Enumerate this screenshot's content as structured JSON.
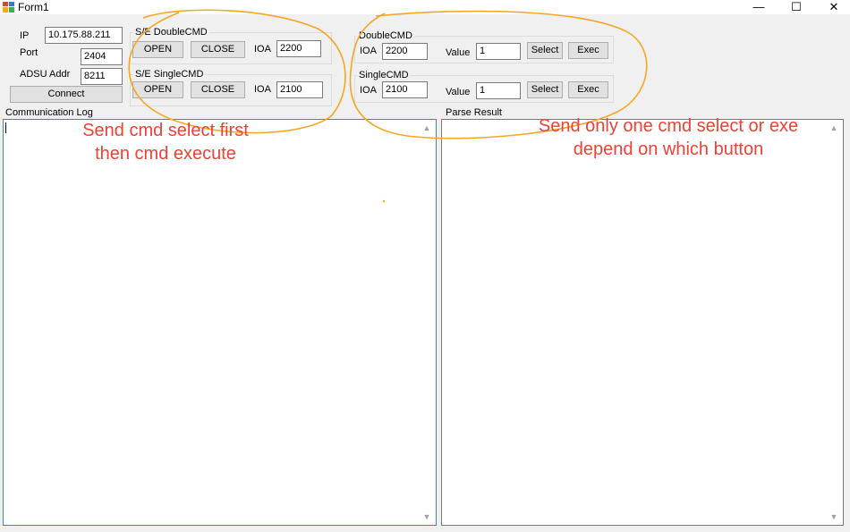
{
  "window": {
    "title": "Form1",
    "minimize_glyph": "—",
    "maximize_glyph": "☐",
    "close_glyph": "✕"
  },
  "connection": {
    "ip_label": "IP",
    "ip_value": "10.175.88.211",
    "port_label": "Port",
    "port_value": "2404",
    "adsu_label": "ADSU Addr",
    "adsu_value": "8211",
    "connect_label": "Connect"
  },
  "se_double": {
    "title": "S/E DoubleCMD",
    "open_label": "OPEN",
    "close_label": "CLOSE",
    "ioa_label": "IOA",
    "ioa_value": "2200"
  },
  "se_single": {
    "title": "S/E SingleCMD",
    "open_label": "OPEN",
    "close_label": "CLOSE",
    "ioa_label": "IOA",
    "ioa_value": "2100"
  },
  "double_cmd": {
    "title": "DoubleCMD",
    "ioa_label": "IOA",
    "ioa_value": "2200",
    "value_label": "Value",
    "value_value": "1",
    "select_label": "Select",
    "exec_label": "Exec"
  },
  "single_cmd": {
    "title": "SingleCMD",
    "ioa_label": "IOA",
    "ioa_value": "2100",
    "value_label": "Value",
    "value_value": "1",
    "select_label": "Select",
    "exec_label": "Exec"
  },
  "communication_log": {
    "label": "Communication Log",
    "content": ""
  },
  "parse_result": {
    "label": "Parse Result",
    "content": ""
  },
  "annotations": {
    "left_line1": "Send cmd select first",
    "left_line2": "then cmd execute",
    "right_line1": "Send  only one cmd select or exe",
    "right_line2": "depend on which button",
    "color": "#ef4135",
    "circle_color": "#f5a623"
  },
  "icons": {
    "scroll_up": "▲",
    "scroll_down": "▼"
  }
}
